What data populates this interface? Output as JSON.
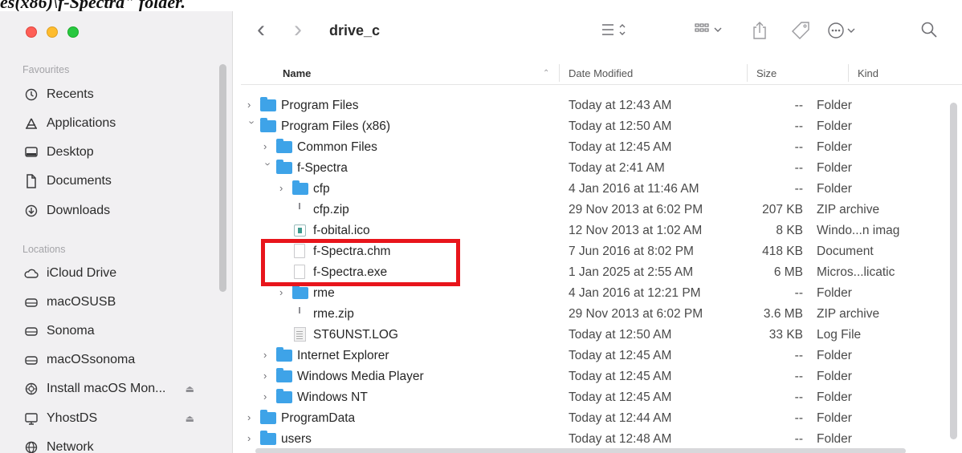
{
  "caption": "es(x86)\\f-Spectra\" folder.",
  "toolbar": {
    "title": "drive_c",
    "back_glyph": "‹",
    "forward_glyph": "›",
    "search_glyph": "⌕"
  },
  "sidebar": {
    "favourites_label": "Favourites",
    "locations_label": "Locations",
    "favourites": [
      {
        "label": "Recents",
        "icon": "clock-icon"
      },
      {
        "label": "Applications",
        "icon": "applications-icon"
      },
      {
        "label": "Desktop",
        "icon": "desktop-icon"
      },
      {
        "label": "Documents",
        "icon": "document-icon"
      },
      {
        "label": "Downloads",
        "icon": "download-icon"
      }
    ],
    "locations": [
      {
        "label": "iCloud Drive",
        "icon": "cloud-icon"
      },
      {
        "label": "macOSUSB",
        "icon": "drive-icon"
      },
      {
        "label": "Sonoma",
        "icon": "drive-icon"
      },
      {
        "label": "macOSsonoma",
        "icon": "drive-icon"
      },
      {
        "label": "Install macOS Mon...",
        "icon": "installer-icon"
      },
      {
        "label": "YhostDS",
        "icon": "display-icon"
      },
      {
        "label": "Network",
        "icon": "network-icon"
      }
    ]
  },
  "columns": {
    "name": "Name",
    "date": "Date Modified",
    "size": "Size",
    "kind": "Kind"
  },
  "files": [
    {
      "name": "Program Files",
      "date": "Today at 12:43 AM",
      "size": "--",
      "kind": "Folder"
    },
    {
      "name": "Program Files (x86)",
      "date": "Today at 12:50 AM",
      "size": "--",
      "kind": "Folder"
    },
    {
      "name": "Common Files",
      "date": "Today at 12:45 AM",
      "size": "--",
      "kind": "Folder"
    },
    {
      "name": "f-Spectra",
      "date": "Today at 2:41 AM",
      "size": "--",
      "kind": "Folder"
    },
    {
      "name": "cfp",
      "date": "4 Jan 2016 at 11:46 AM",
      "size": "--",
      "kind": "Folder"
    },
    {
      "name": "cfp.zip",
      "date": "29 Nov 2013 at 6:02 PM",
      "size": "207 KB",
      "kind": "ZIP archive"
    },
    {
      "name": "f-obital.ico",
      "date": "12 Nov 2013 at 1:02 AM",
      "size": "8 KB",
      "kind": "Windo...n imag"
    },
    {
      "name": "f-Spectra.chm",
      "date": "7 Jun 2016 at 8:02 PM",
      "size": "418 KB",
      "kind": "Document"
    },
    {
      "name": "f-Spectra.exe",
      "date": "1 Jan 2025 at 2:55 AM",
      "size": "6 MB",
      "kind": "Micros...licatic"
    },
    {
      "name": "rme",
      "date": "4 Jan 2016 at 12:21 PM",
      "size": "--",
      "kind": "Folder"
    },
    {
      "name": "rme.zip",
      "date": "29 Nov 2013 at 6:02 PM",
      "size": "3.6 MB",
      "kind": "ZIP archive"
    },
    {
      "name": "ST6UNST.LOG",
      "date": "Today at 12:50 AM",
      "size": "33 KB",
      "kind": "Log File"
    },
    {
      "name": "Internet Explorer",
      "date": "Today at 12:45 AM",
      "size": "--",
      "kind": "Folder"
    },
    {
      "name": "Windows Media Player",
      "date": "Today at 12:45 AM",
      "size": "--",
      "kind": "Folder"
    },
    {
      "name": "Windows NT",
      "date": "Today at 12:45 AM",
      "size": "--",
      "kind": "Folder"
    },
    {
      "name": "ProgramData",
      "date": "Today at 12:44 AM",
      "size": "--",
      "kind": "Folder"
    },
    {
      "name": "users",
      "date": "Today at 12:48 AM",
      "size": "--",
      "kind": "Folder"
    }
  ],
  "colors": {
    "accent": "#3ea3e8",
    "highlight": "#e8151b"
  }
}
